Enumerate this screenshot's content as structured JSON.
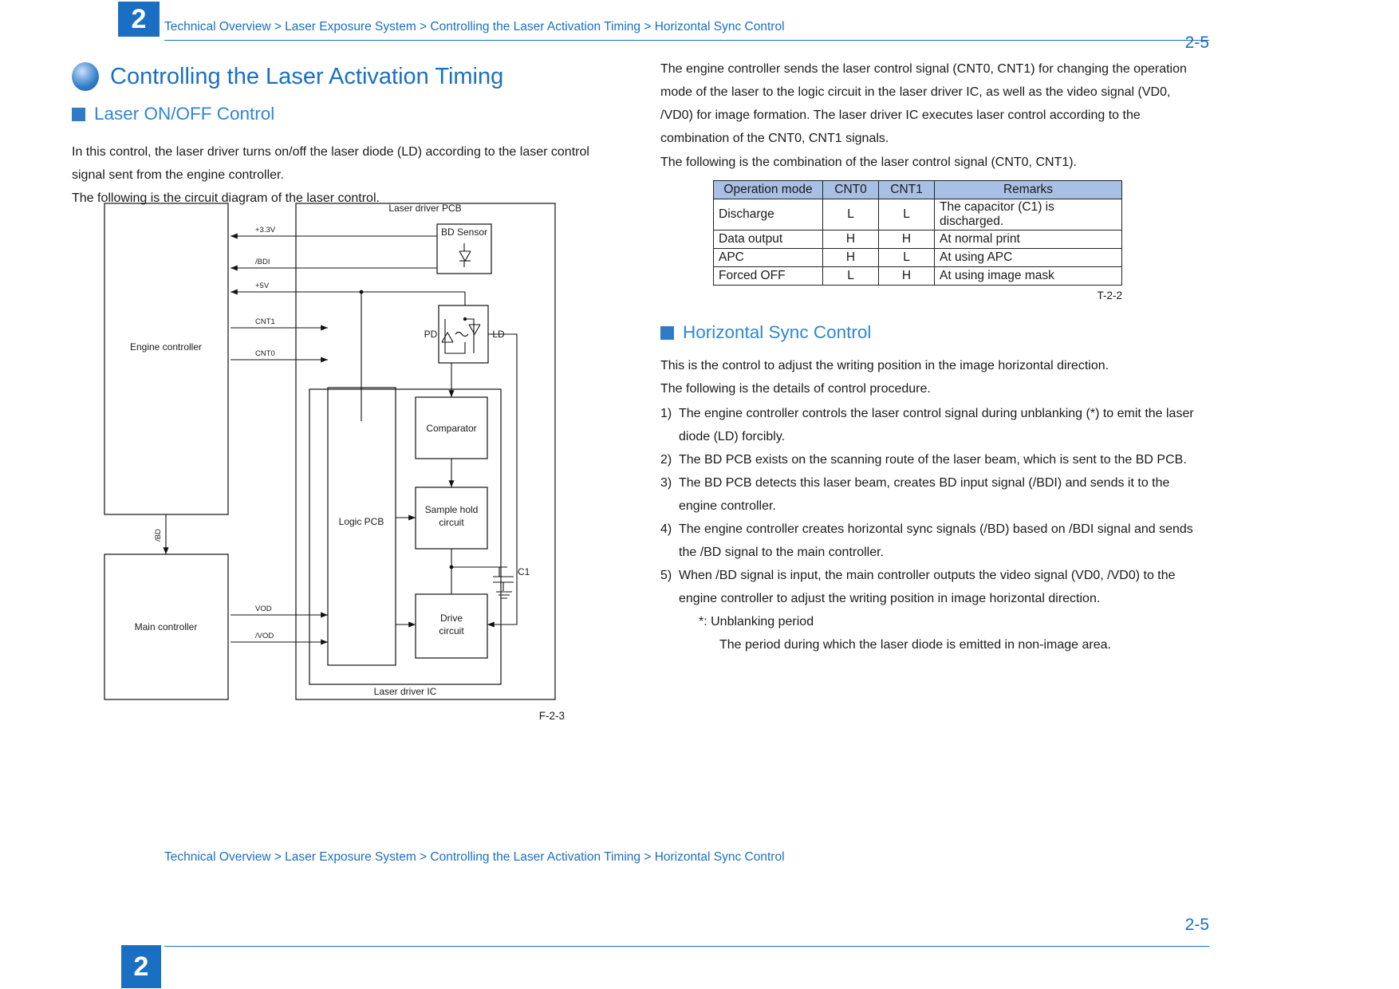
{
  "header": {
    "chapter": "2",
    "breadcrumb": "Technical Overview > Laser Exposure System > Controlling the Laser Activation Timing > Horizontal Sync Control",
    "page_number": "2-5"
  },
  "footer": {
    "chapter": "2",
    "breadcrumb": "Technical Overview > Laser Exposure System > Controlling the Laser Activation Timing > Horizontal Sync Control",
    "page_number": "2-5"
  },
  "left": {
    "title": "Controlling the Laser Activation Timing",
    "section_heading": "Laser ON/OFF Control",
    "para1": "In this control, the laser driver turns on/off the laser diode (LD) according to the laser control signal sent from the engine controller.",
    "para2": "The following is the circuit diagram of the laser control.",
    "figure_caption": "F-2-3"
  },
  "figure": {
    "engine_controller": "Engine controller",
    "main_controller": "Main controller",
    "laser_driver_pcb": "Laser driver PCB",
    "laser_driver_ic": "Laser driver IC",
    "logic_pcb": "Logic PCB",
    "bd_sensor": "BD Sensor",
    "comparator": "Comparator",
    "sample_hold": "Sample hold",
    "sample_hold_2": "circuit",
    "drive": "Drive",
    "drive_2": "circuit",
    "pd": "PD",
    "ld": "LD",
    "capacitor": "C1",
    "signal_33v": "+3.3V",
    "signal_bdi": "/BDI",
    "signal_5v": "+5V",
    "signal_cnt1": "CNT1",
    "signal_cnt0": "CNT0",
    "signal_bd": "/BD",
    "signal_vod": "VOD",
    "signal_nvod": "/VOD"
  },
  "right": {
    "para1": "The engine controller sends the laser control signal (CNT0, CNT1) for changing the operation mode of the laser to the logic circuit in the laser driver IC, as well as the video signal (VD0, /VD0) for image formation. The laser driver IC executes laser control according to the combination of the CNT0, CNT1 signals.",
    "para2": "The following is the combination of the laser control signal (CNT0, CNT1).",
    "table_caption": "T-2-2",
    "section_heading": "Horizontal Sync Control",
    "para3": "This is the control to adjust the writing position in the image horizontal direction.",
    "para4": "The following is the details of control procedure.",
    "steps": [
      {
        "no": "1)",
        "text": "The engine controller controls the laser control signal during unblanking (*) to emit the laser diode (LD) forcibly."
      },
      {
        "no": "2)",
        "text": "The BD PCB exists on the scanning route of the laser beam, which is sent to the BD PCB."
      },
      {
        "no": "3)",
        "text": "The BD PCB detects this laser beam, creates BD input signal (/BDI) and sends it to the engine controller."
      },
      {
        "no": "4)",
        "text": "The engine controller creates horizontal sync signals (/BD) based on /BDI signal and sends the /BD signal to the main controller."
      },
      {
        "no": "5)",
        "text": "When /BD signal is input, the main controller outputs the video signal (VD0, /VD0) to the engine controller to adjust the writing position in image horizontal direction."
      }
    ],
    "note1": "*: Unblanking period",
    "note2": "The period during which the laser diode is emitted in non-image area."
  },
  "table": {
    "headers": [
      "Operation mode",
      "CNT0",
      "CNT1",
      "Remarks"
    ],
    "rows": [
      {
        "mode": "Discharge",
        "cnt0": "L",
        "cnt1": "L",
        "remarks": "The capacitor (C1) is discharged."
      },
      {
        "mode": "Data output",
        "cnt0": "H",
        "cnt1": "H",
        "remarks": "At normal print"
      },
      {
        "mode": "APC",
        "cnt0": "H",
        "cnt1": "L",
        "remarks": "At using APC"
      },
      {
        "mode": "Forced OFF",
        "cnt0": "L",
        "cnt1": "H",
        "remarks": "At using image mask"
      }
    ]
  },
  "colors": {
    "accent": "#1b6fc2",
    "heading": "#2f86d6",
    "table_header_bg": "#a8c0e4"
  }
}
